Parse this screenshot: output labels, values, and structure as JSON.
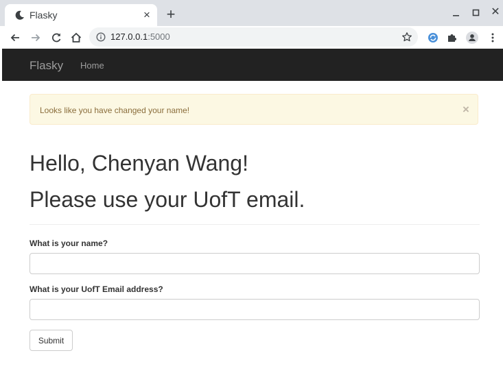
{
  "browser": {
    "tab_title": "Flasky",
    "tab_close": "×",
    "new_tab": "+",
    "window_close": "✕",
    "url_host": "127.0.0.1",
    "url_port": ":5000",
    "icons": [
      "moon-favicon-icon",
      "back-icon",
      "forward-icon",
      "reload-icon",
      "home-icon",
      "info-icon",
      "star-icon",
      "extension-sync-icon",
      "puzzle-icon",
      "profile-icon",
      "menu-icon"
    ]
  },
  "navbar": {
    "brand": "Flasky",
    "links": [
      {
        "label": "Home"
      }
    ]
  },
  "alert": {
    "message": "Looks like you have changed your name!",
    "close": "×"
  },
  "page": {
    "greeting": "Hello, Chenyan Wang!",
    "notice": "Please use your UofT email."
  },
  "form": {
    "name_label": "What is your name?",
    "name_value": "",
    "email_label": "What is your UofT Email address?",
    "email_value": "",
    "submit_label": "Submit"
  },
  "colors": {
    "navbar_bg": "#222222",
    "alert_bg": "#fcf8e3",
    "alert_text": "#8a6d3b",
    "text": "#333333"
  }
}
